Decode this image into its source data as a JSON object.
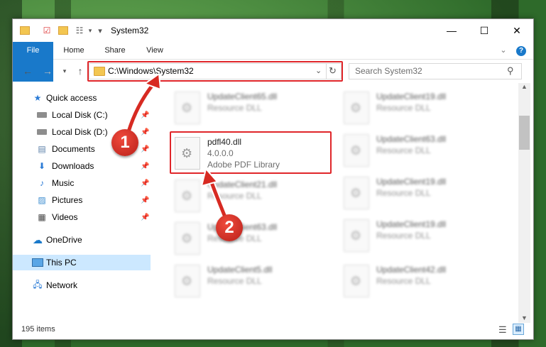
{
  "window": {
    "title": "System32",
    "controls": {
      "minimize": "—",
      "maximize": "☐",
      "close": "✕"
    }
  },
  "ribbon": {
    "tabs": [
      "File",
      "Home",
      "Share",
      "View"
    ]
  },
  "address": {
    "path": "C:\\Windows\\System32",
    "search_placeholder": "Search System32"
  },
  "sidebar": {
    "items": [
      {
        "label": "Quick access",
        "icon": "star-icon"
      },
      {
        "label": "Local Disk (C:)",
        "icon": "drive-icon",
        "pinned": true
      },
      {
        "label": "Local Disk (D:)",
        "icon": "drive-icon",
        "pinned": true
      },
      {
        "label": "Documents",
        "icon": "documents-icon",
        "pinned": true
      },
      {
        "label": "Downloads",
        "icon": "downloads-icon",
        "pinned": true
      },
      {
        "label": "Music",
        "icon": "music-icon",
        "pinned": true
      },
      {
        "label": "Pictures",
        "icon": "pictures-icon",
        "pinned": true
      },
      {
        "label": "Videos",
        "icon": "videos-icon",
        "pinned": true
      },
      {
        "label": "OneDrive",
        "icon": "cloud-icon"
      },
      {
        "label": "This PC",
        "icon": "computer-icon",
        "selected": true
      },
      {
        "label": "Network",
        "icon": "network-icon"
      }
    ]
  },
  "files": {
    "left_column": [
      {
        "name": "UpdateClient65.dll",
        "type": "Resource DLL"
      },
      {
        "name": "pdfl40.dll",
        "version": "4.0.0.0",
        "type": "Adobe PDF Library",
        "highlighted": true
      },
      {
        "name": "UpdateClient21.dll",
        "type": "Resource DLL"
      },
      {
        "name": "UpdateClient63.dll",
        "type": "Resource DLL"
      },
      {
        "name": "UpdateClient5.dll",
        "type": "Resource DLL"
      }
    ],
    "right_column": [
      {
        "name": "UpdateClient19.dll",
        "type": "Resource DLL"
      },
      {
        "name": "UpdateClient63.dll",
        "type": "Resource DLL"
      },
      {
        "name": "UpdateClient19.dll",
        "type": "Resource DLL"
      },
      {
        "name": "UpdateClient19.dll",
        "type": "Resource DLL"
      },
      {
        "name": "UpdateClient42.dll",
        "type": "Resource DLL"
      }
    ]
  },
  "status": {
    "item_count": "195 items"
  },
  "markers": {
    "one": "1",
    "two": "2"
  },
  "colors": {
    "accent": "#1979ca",
    "highlight": "#e0262a",
    "selected_bg": "#cce8ff"
  }
}
